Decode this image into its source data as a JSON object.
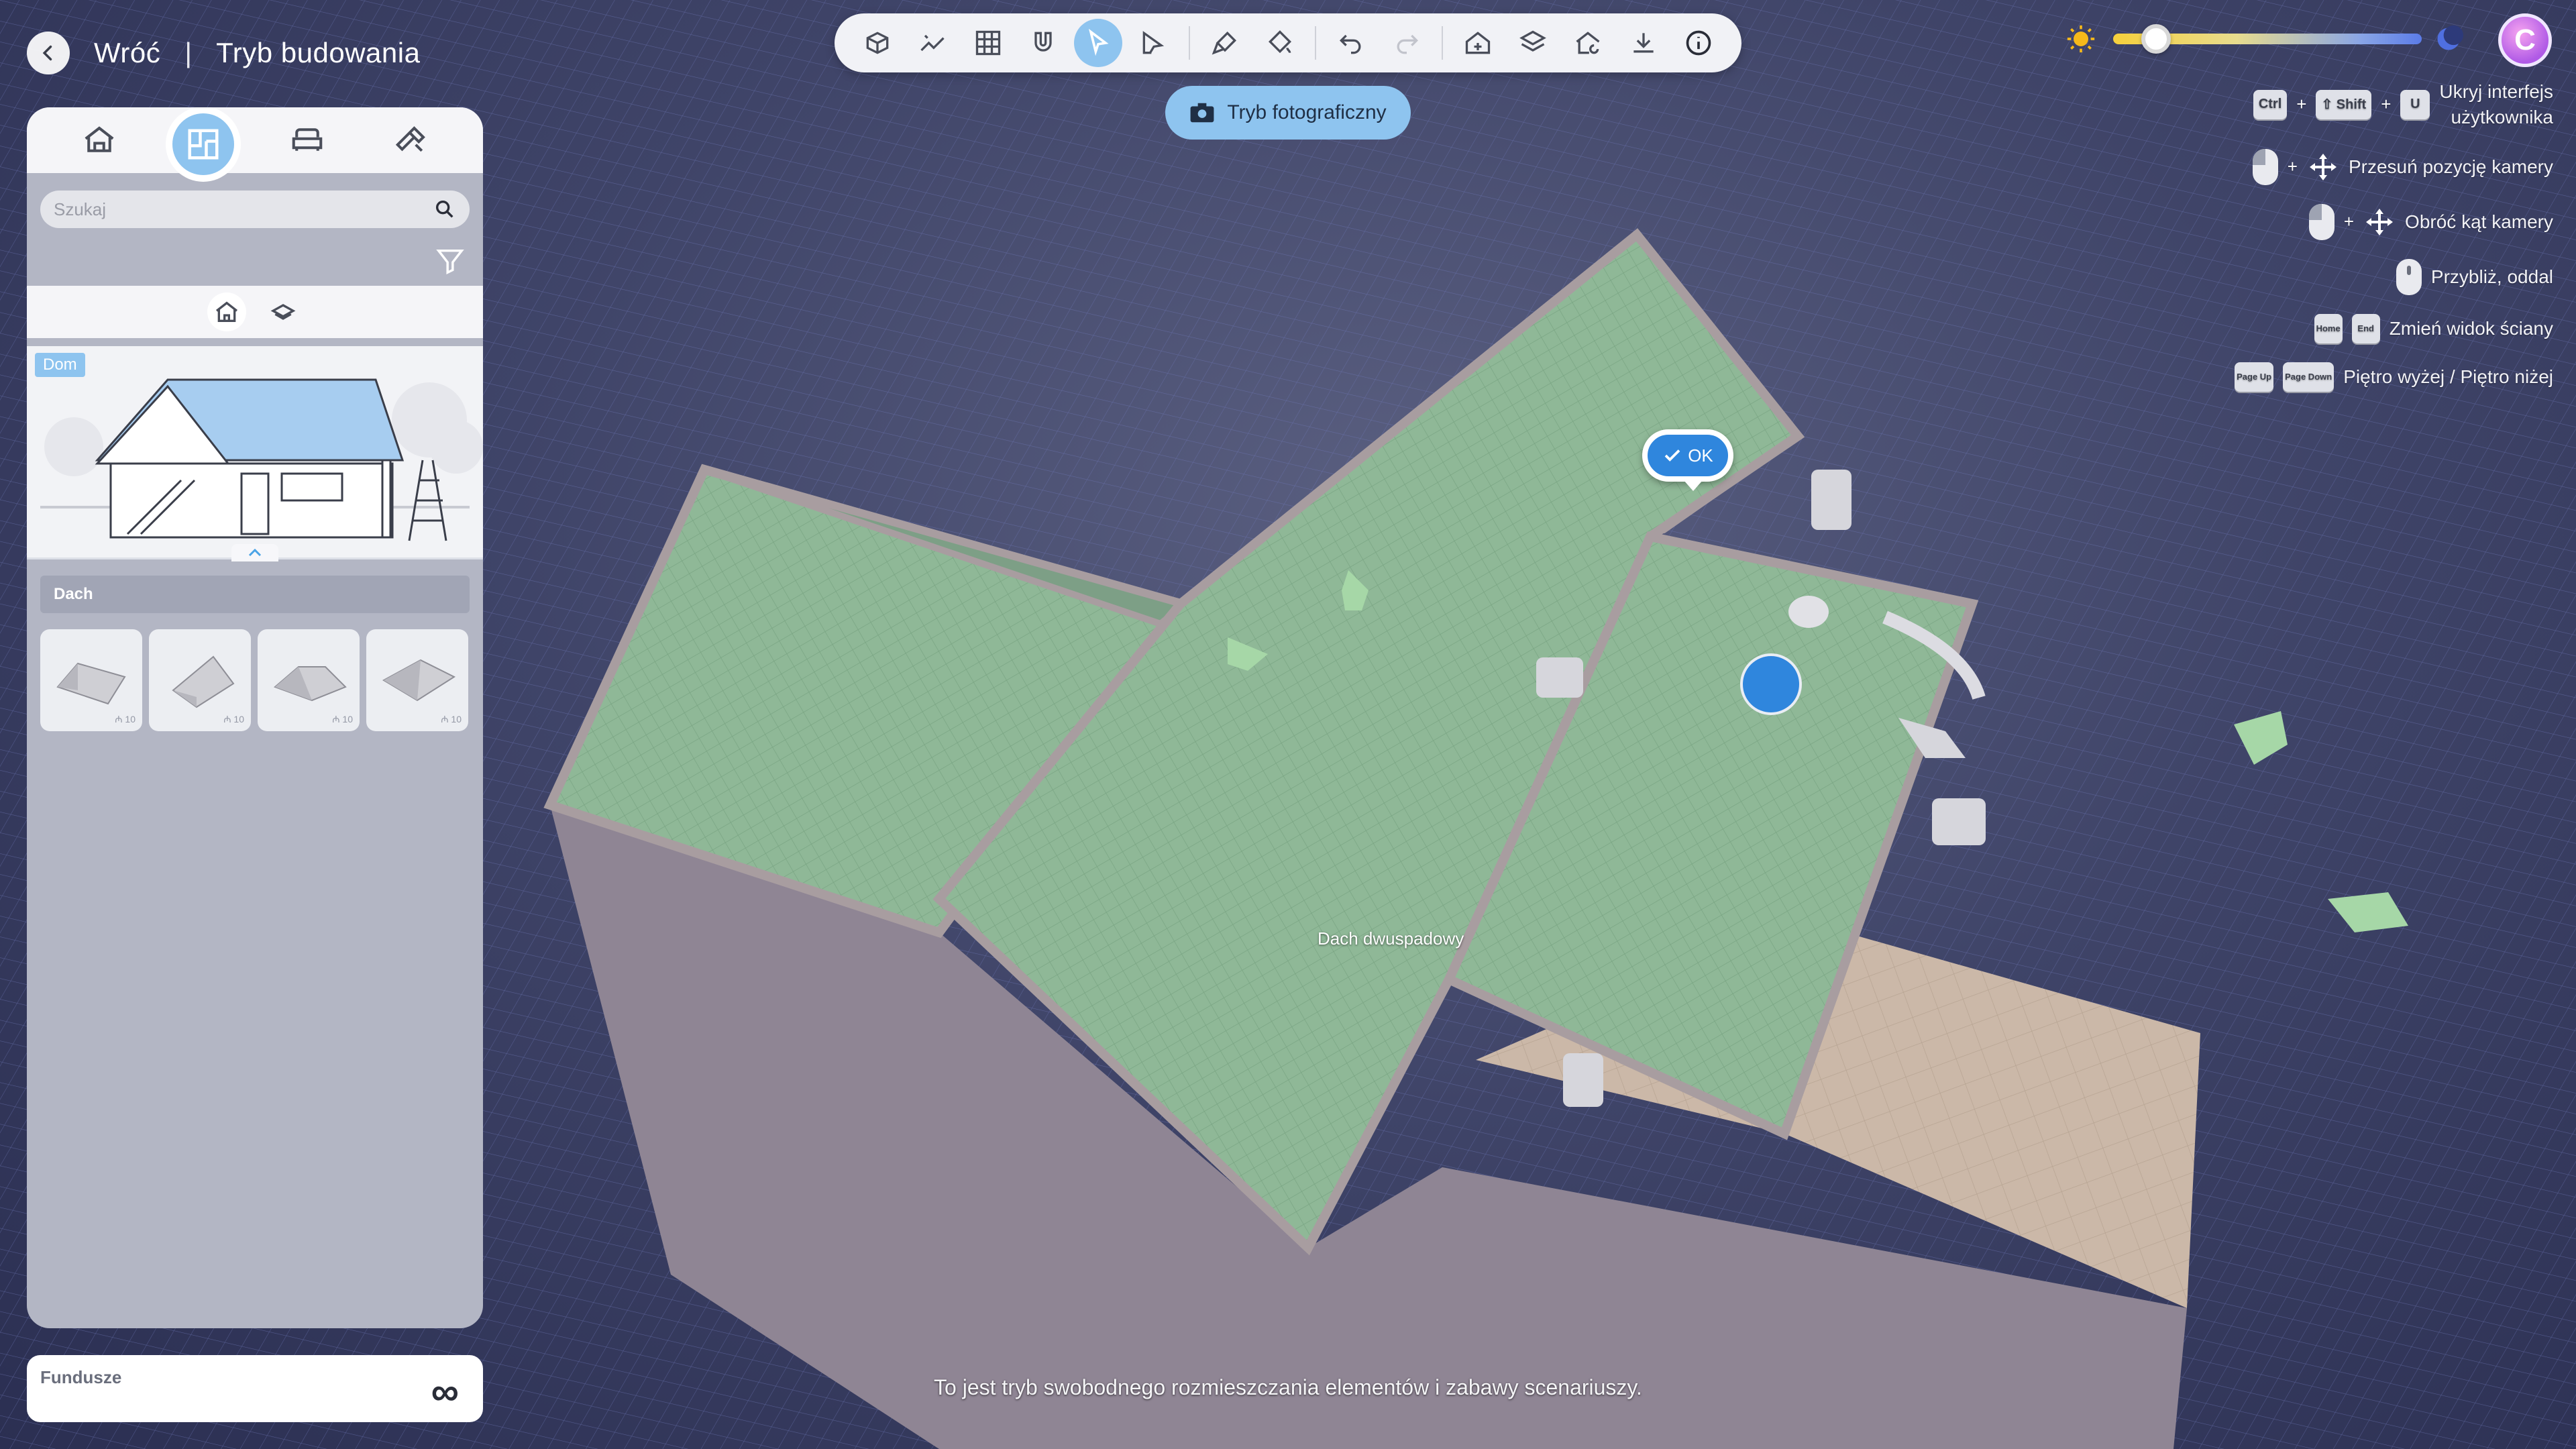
{
  "nav": {
    "back_label": "Wróć",
    "separator": "|",
    "mode_title": "Tryb budowania"
  },
  "toolbar": {
    "tools": [
      {
        "icon": "house-cube-icon"
      },
      {
        "icon": "wall-draw-icon"
      },
      {
        "icon": "grid-icon"
      },
      {
        "icon": "magnet-icon"
      },
      {
        "icon": "select-cursor-icon",
        "active": true
      },
      {
        "icon": "measure-cursor-icon"
      },
      {
        "icon": "paint-brush-icon"
      },
      {
        "icon": "paint-fill-icon"
      },
      {
        "icon": "undo-icon"
      },
      {
        "icon": "redo-icon"
      },
      {
        "icon": "house-plus-icon"
      },
      {
        "icon": "layer-house-icon"
      },
      {
        "icon": "house-refresh-icon"
      },
      {
        "icon": "download-icon"
      },
      {
        "icon": "info-icon"
      }
    ]
  },
  "photo_mode": {
    "label": "Tryb fotograficzny",
    "icon": "camera-icon"
  },
  "time_of_day": {
    "value": 0.14,
    "start_icon": "sun-icon",
    "end_icon": "moon-icon"
  },
  "avatar": {
    "initial": "C",
    "color": "#b05ae6"
  },
  "shortcuts": [
    {
      "keys": [
        "Ctrl",
        "⇧ Shift",
        "U"
      ],
      "label_line1": "Ukryj interfejs",
      "label_line2": "użytkownika"
    },
    {
      "keys": [
        "mouse-left",
        "move-arrows"
      ],
      "label": "Przesuń pozycję kamery"
    },
    {
      "keys": [
        "mouse-left",
        "move-arrows"
      ],
      "label": "Obróć kąt kamery"
    },
    {
      "keys": [
        "mouse-wheel"
      ],
      "label": "Przybliż, oddal"
    },
    {
      "keys": [
        "Home",
        "End"
      ],
      "label": "Zmień widok ściany"
    },
    {
      "keys": [
        "Page Up",
        "Page Down"
      ],
      "label": "Piętro wyżej / Piętro niżej"
    }
  ],
  "panel": {
    "tabs": [
      {
        "icon": "house-icon"
      },
      {
        "icon": "floorplan-icon",
        "active": true
      },
      {
        "icon": "sofa-icon"
      },
      {
        "icon": "hammer-icon"
      }
    ],
    "search_placeholder": "Szukaj",
    "subtabs": [
      {
        "icon": "home-outline-icon",
        "active": true
      },
      {
        "icon": "layers-icon"
      }
    ],
    "preview_badge": "Dom",
    "section_title": "Dach",
    "items": [
      {
        "icon": "gable-roof-icon",
        "cost": "10"
      },
      {
        "icon": "shed-roof-icon",
        "cost": "10"
      },
      {
        "icon": "hip-roof-icon",
        "cost": "10"
      },
      {
        "icon": "pyramid-roof-icon",
        "cost": "10"
      }
    ]
  },
  "funds": {
    "label": "Fundusze",
    "value": "∞"
  },
  "scene": {
    "ok_label": "OK",
    "roof_label": "Dach dwuspadowy",
    "roof_color": "#8db595",
    "grid_color": "#2f3a73"
  },
  "status_message": "To jest tryb swobodnego rozmieszczania elementów i zabawy scenariuszy."
}
